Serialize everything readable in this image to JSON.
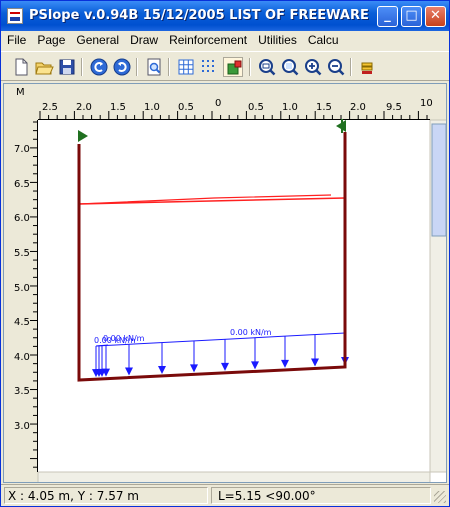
{
  "window": {
    "title": "PSlope v.0.94B 15/12/2005  LIST OF FREEWARE",
    "minimize_glyph": "_",
    "maximize_glyph": "□",
    "close_glyph": "✕"
  },
  "menu": [
    {
      "label": "File"
    },
    {
      "label": "Page"
    },
    {
      "label": "General"
    },
    {
      "label": "Draw"
    },
    {
      "label": "Reinforcement"
    },
    {
      "label": "Utilities"
    },
    {
      "label": "Calcu"
    }
  ],
  "toolbar": [
    {
      "icon": "new-file-icon"
    },
    {
      "icon": "open-folder-icon"
    },
    {
      "icon": "save-disk-icon"
    },
    {
      "icon": "undo-icon"
    },
    {
      "icon": "redo-icon"
    },
    {
      "icon": "print-preview-icon"
    },
    {
      "icon": "grid-icon"
    },
    {
      "icon": "snap-grid-icon"
    },
    {
      "icon": "snap-point-icon"
    },
    {
      "icon": "zoom-window-icon"
    },
    {
      "icon": "zoom-extents-icon"
    },
    {
      "icon": "zoom-in-icon"
    },
    {
      "icon": "zoom-out-icon"
    },
    {
      "icon": "layer-icon"
    }
  ],
  "canvas": {
    "unit_label": "M",
    "x_ticks": [
      "2.5",
      "2.0",
      "1.5",
      "1.0",
      "0.5",
      "0",
      "0.5",
      "1.0",
      "1.5",
      "2.0",
      "9.5",
      "10"
    ],
    "y_ticks": [
      "7.0",
      "6.5",
      "6.0",
      "5.5",
      "5.0",
      "4.5",
      "4.0",
      "3.5",
      "3.0"
    ],
    "load_labels": [
      "0.00 kN/m",
      "0.00 kN/m",
      "0.00 kN/m"
    ],
    "colors": {
      "wall": "#7a0a0a",
      "water_line": "#ff2020",
      "load": "#1a1aff",
      "marker": "#207020"
    }
  },
  "status": {
    "coords": "X : 4.05 m, Y : 7.57 m",
    "length": "L=5.15 <90.00°"
  }
}
